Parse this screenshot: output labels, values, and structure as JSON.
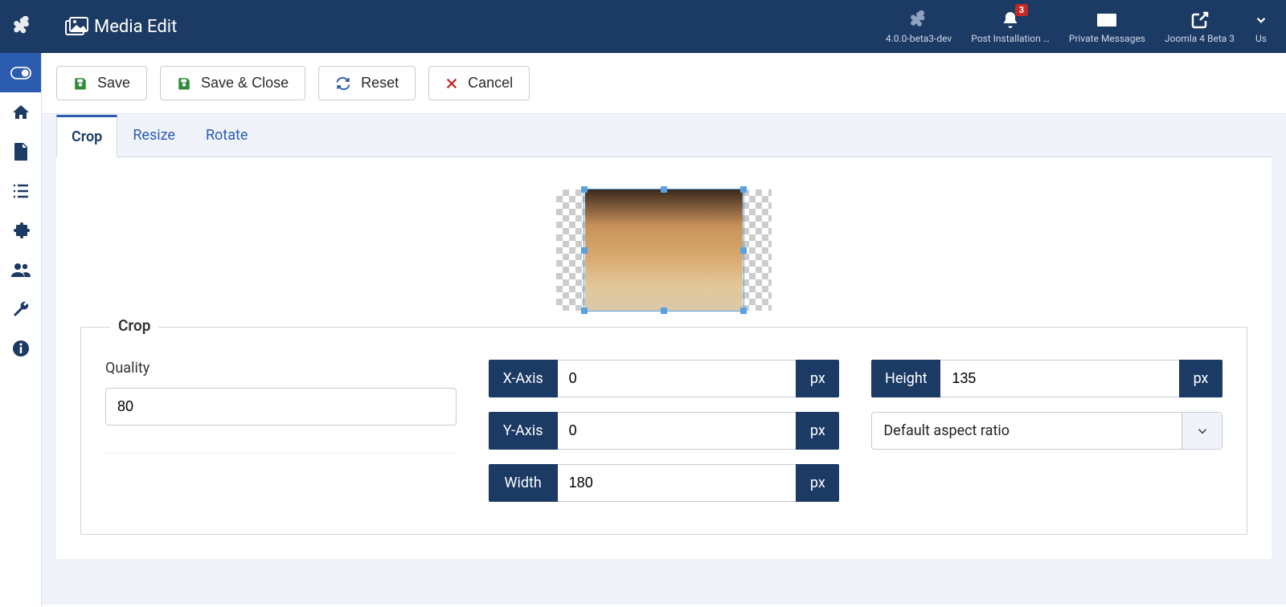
{
  "header": {
    "title": "Media Edit",
    "items": [
      {
        "icon": "joomla",
        "label": "4.0.0-beta3-dev",
        "badge": null
      },
      {
        "icon": "bell",
        "label": "Post Installation …",
        "badge": "3"
      },
      {
        "icon": "envelope",
        "label": "Private Messages",
        "badge": null
      },
      {
        "icon": "external",
        "label": "Joomla 4 Beta 3",
        "badge": null
      },
      {
        "icon": "chevron-down",
        "label": "Us",
        "badge": null
      }
    ]
  },
  "sidebar": {
    "items": [
      {
        "icon": "toggle",
        "active": true
      },
      {
        "icon": "home",
        "active": false
      },
      {
        "icon": "file",
        "active": false
      },
      {
        "icon": "list",
        "active": false
      },
      {
        "icon": "puzzle",
        "active": false
      },
      {
        "icon": "users",
        "active": false
      },
      {
        "icon": "wrench",
        "active": false
      },
      {
        "icon": "info",
        "active": false
      }
    ]
  },
  "toolbar": {
    "save_label": "Save",
    "save_close_label": "Save & Close",
    "reset_label": "Reset",
    "cancel_label": "Cancel"
  },
  "tabs": [
    {
      "id": "crop",
      "label": "Crop",
      "active": true
    },
    {
      "id": "resize",
      "label": "Resize",
      "active": false
    },
    {
      "id": "rotate",
      "label": "Rotate",
      "active": false
    }
  ],
  "crop_form": {
    "legend": "Crop",
    "quality_label": "Quality",
    "quality_value": "80",
    "x_label": "X-Axis",
    "x_value": "0",
    "y_label": "Y-Axis",
    "y_value": "0",
    "w_label": "Width",
    "w_value": "180",
    "h_label": "Height",
    "h_value": "135",
    "unit": "px",
    "aspect_label": "Default aspect ratio"
  }
}
